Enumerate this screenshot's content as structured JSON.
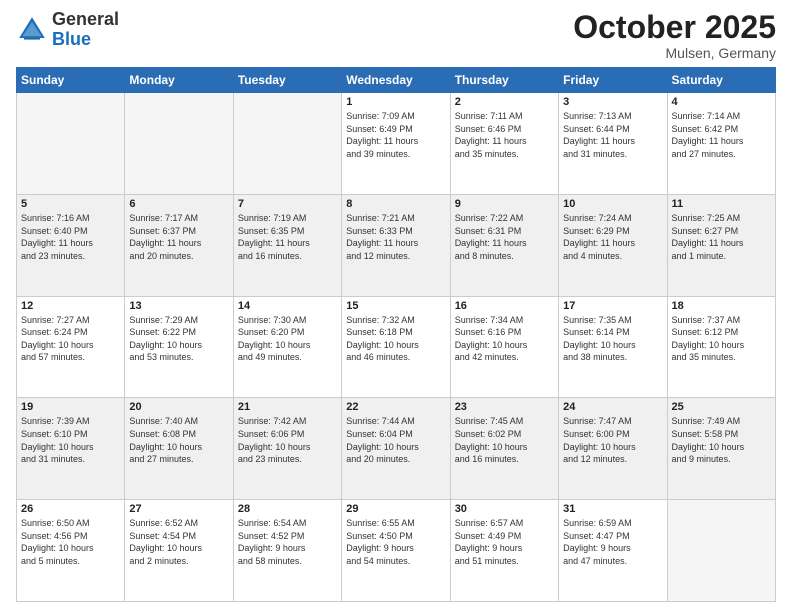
{
  "header": {
    "logo_general": "General",
    "logo_blue": "Blue",
    "month": "October 2025",
    "location": "Mulsen, Germany"
  },
  "weekdays": [
    "Sunday",
    "Monday",
    "Tuesday",
    "Wednesday",
    "Thursday",
    "Friday",
    "Saturday"
  ],
  "weeks": [
    [
      {
        "day": "",
        "info": ""
      },
      {
        "day": "",
        "info": ""
      },
      {
        "day": "",
        "info": ""
      },
      {
        "day": "1",
        "info": "Sunrise: 7:09 AM\nSunset: 6:49 PM\nDaylight: 11 hours\nand 39 minutes."
      },
      {
        "day": "2",
        "info": "Sunrise: 7:11 AM\nSunset: 6:46 PM\nDaylight: 11 hours\nand 35 minutes."
      },
      {
        "day": "3",
        "info": "Sunrise: 7:13 AM\nSunset: 6:44 PM\nDaylight: 11 hours\nand 31 minutes."
      },
      {
        "day": "4",
        "info": "Sunrise: 7:14 AM\nSunset: 6:42 PM\nDaylight: 11 hours\nand 27 minutes."
      }
    ],
    [
      {
        "day": "5",
        "info": "Sunrise: 7:16 AM\nSunset: 6:40 PM\nDaylight: 11 hours\nand 23 minutes."
      },
      {
        "day": "6",
        "info": "Sunrise: 7:17 AM\nSunset: 6:37 PM\nDaylight: 11 hours\nand 20 minutes."
      },
      {
        "day": "7",
        "info": "Sunrise: 7:19 AM\nSunset: 6:35 PM\nDaylight: 11 hours\nand 16 minutes."
      },
      {
        "day": "8",
        "info": "Sunrise: 7:21 AM\nSunset: 6:33 PM\nDaylight: 11 hours\nand 12 minutes."
      },
      {
        "day": "9",
        "info": "Sunrise: 7:22 AM\nSunset: 6:31 PM\nDaylight: 11 hours\nand 8 minutes."
      },
      {
        "day": "10",
        "info": "Sunrise: 7:24 AM\nSunset: 6:29 PM\nDaylight: 11 hours\nand 4 minutes."
      },
      {
        "day": "11",
        "info": "Sunrise: 7:25 AM\nSunset: 6:27 PM\nDaylight: 11 hours\nand 1 minute."
      }
    ],
    [
      {
        "day": "12",
        "info": "Sunrise: 7:27 AM\nSunset: 6:24 PM\nDaylight: 10 hours\nand 57 minutes."
      },
      {
        "day": "13",
        "info": "Sunrise: 7:29 AM\nSunset: 6:22 PM\nDaylight: 10 hours\nand 53 minutes."
      },
      {
        "day": "14",
        "info": "Sunrise: 7:30 AM\nSunset: 6:20 PM\nDaylight: 10 hours\nand 49 minutes."
      },
      {
        "day": "15",
        "info": "Sunrise: 7:32 AM\nSunset: 6:18 PM\nDaylight: 10 hours\nand 46 minutes."
      },
      {
        "day": "16",
        "info": "Sunrise: 7:34 AM\nSunset: 6:16 PM\nDaylight: 10 hours\nand 42 minutes."
      },
      {
        "day": "17",
        "info": "Sunrise: 7:35 AM\nSunset: 6:14 PM\nDaylight: 10 hours\nand 38 minutes."
      },
      {
        "day": "18",
        "info": "Sunrise: 7:37 AM\nSunset: 6:12 PM\nDaylight: 10 hours\nand 35 minutes."
      }
    ],
    [
      {
        "day": "19",
        "info": "Sunrise: 7:39 AM\nSunset: 6:10 PM\nDaylight: 10 hours\nand 31 minutes."
      },
      {
        "day": "20",
        "info": "Sunrise: 7:40 AM\nSunset: 6:08 PM\nDaylight: 10 hours\nand 27 minutes."
      },
      {
        "day": "21",
        "info": "Sunrise: 7:42 AM\nSunset: 6:06 PM\nDaylight: 10 hours\nand 23 minutes."
      },
      {
        "day": "22",
        "info": "Sunrise: 7:44 AM\nSunset: 6:04 PM\nDaylight: 10 hours\nand 20 minutes."
      },
      {
        "day": "23",
        "info": "Sunrise: 7:45 AM\nSunset: 6:02 PM\nDaylight: 10 hours\nand 16 minutes."
      },
      {
        "day": "24",
        "info": "Sunrise: 7:47 AM\nSunset: 6:00 PM\nDaylight: 10 hours\nand 12 minutes."
      },
      {
        "day": "25",
        "info": "Sunrise: 7:49 AM\nSunset: 5:58 PM\nDaylight: 10 hours\nand 9 minutes."
      }
    ],
    [
      {
        "day": "26",
        "info": "Sunrise: 6:50 AM\nSunset: 4:56 PM\nDaylight: 10 hours\nand 5 minutes."
      },
      {
        "day": "27",
        "info": "Sunrise: 6:52 AM\nSunset: 4:54 PM\nDaylight: 10 hours\nand 2 minutes."
      },
      {
        "day": "28",
        "info": "Sunrise: 6:54 AM\nSunset: 4:52 PM\nDaylight: 9 hours\nand 58 minutes."
      },
      {
        "day": "29",
        "info": "Sunrise: 6:55 AM\nSunset: 4:50 PM\nDaylight: 9 hours\nand 54 minutes."
      },
      {
        "day": "30",
        "info": "Sunrise: 6:57 AM\nSunset: 4:49 PM\nDaylight: 9 hours\nand 51 minutes."
      },
      {
        "day": "31",
        "info": "Sunrise: 6:59 AM\nSunset: 4:47 PM\nDaylight: 9 hours\nand 47 minutes."
      },
      {
        "day": "",
        "info": ""
      }
    ]
  ]
}
